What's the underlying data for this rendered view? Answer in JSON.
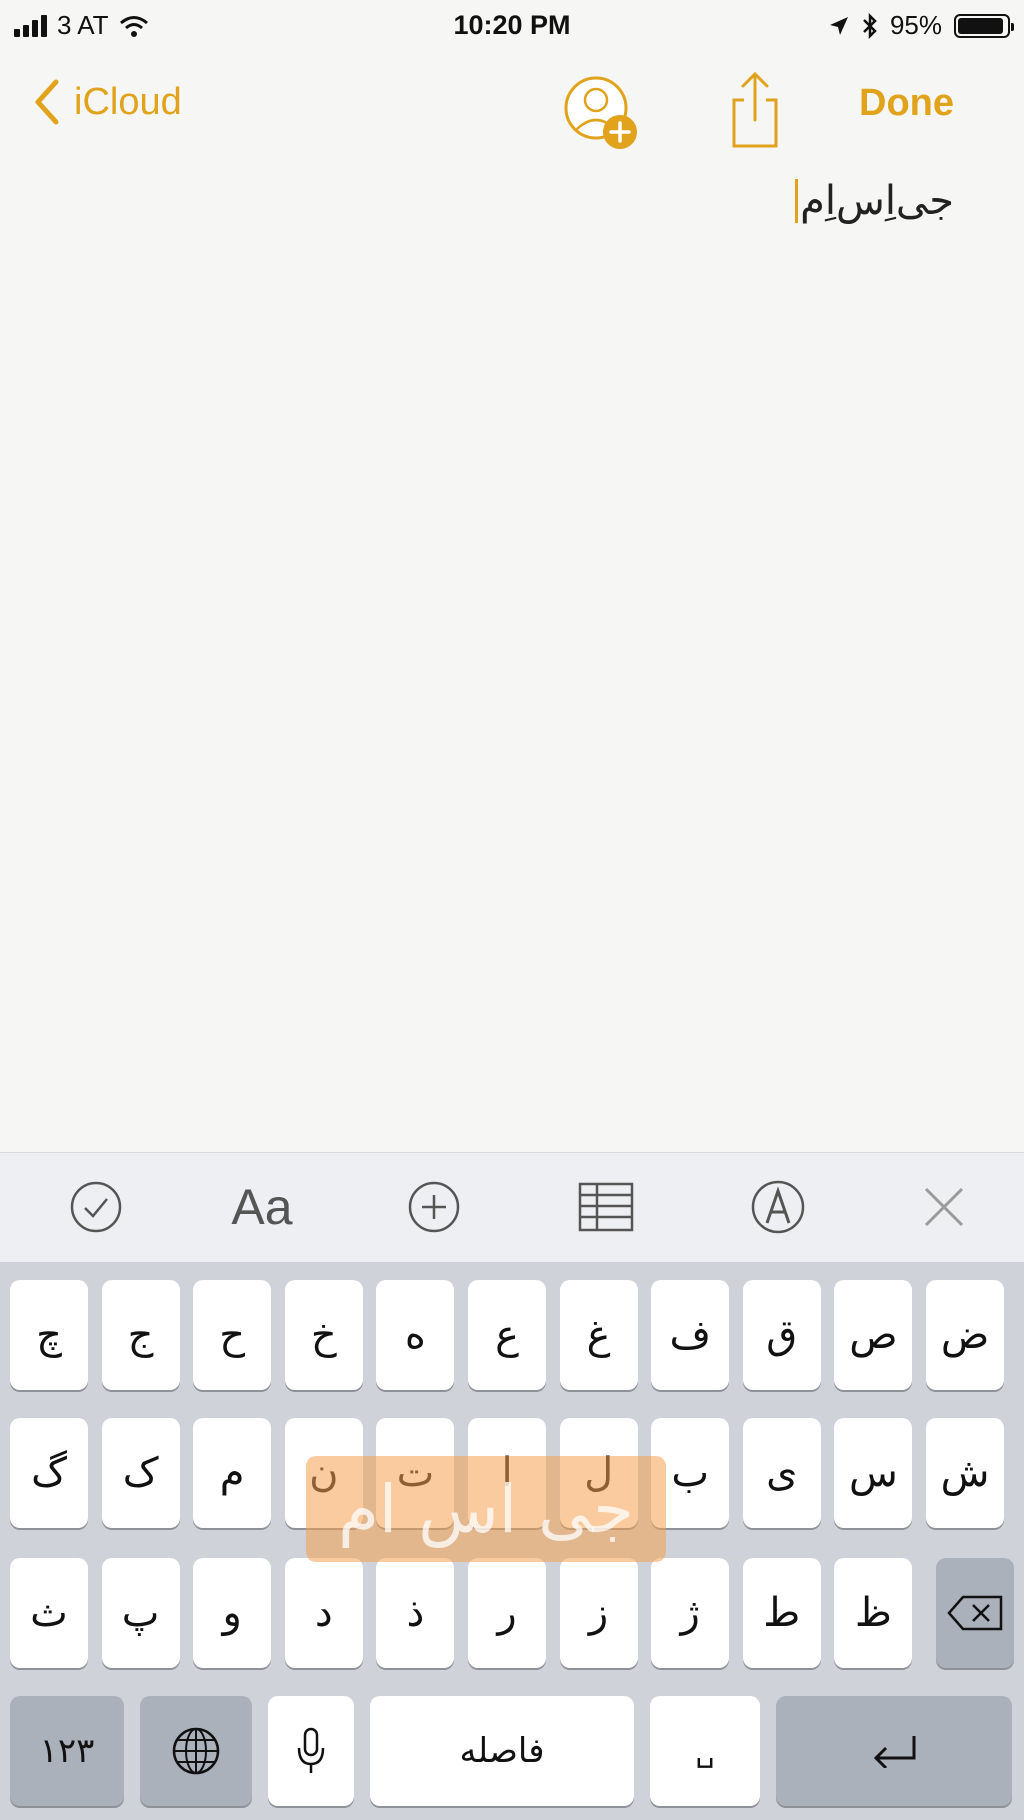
{
  "status": {
    "carrier": "3 AT",
    "time": "10:20 PM",
    "battery": "95%",
    "battery_level": 0.95
  },
  "nav": {
    "back_label": "iCloud",
    "done_label": "Done"
  },
  "note": {
    "text": "جی‌اِس‌اِم"
  },
  "colors": {
    "accent": "#e0a31b",
    "paper": "#f6f6f4",
    "key": "#ffffff",
    "key_dark": "#abb1bb",
    "keyboard_bg": "#cfd3d9"
  },
  "toolbar": {
    "format_label": "Aa",
    "icons": [
      "checklist-icon",
      "format-icon",
      "add-icon",
      "table-icon",
      "markup-icon",
      "close-icon"
    ]
  },
  "keyboard": {
    "row1": [
      "ض",
      "ص",
      "ق",
      "ف",
      "غ",
      "ع",
      "ه",
      "خ",
      "ح",
      "ج",
      "چ"
    ],
    "row2": [
      "ش",
      "س",
      "ی",
      "ب",
      "ل",
      "ا",
      "ت",
      "ن",
      "م",
      "ک",
      "گ"
    ],
    "row3": [
      "ظ",
      "ط",
      "ژ",
      "ز",
      "ر",
      "ذ",
      "د",
      "و",
      "پ",
      "ث"
    ],
    "numbers_label": "۱۲۳",
    "space_label": "فاصله",
    "zwnj_label": "␣"
  },
  "watermark": {
    "text": "جی اس ام"
  }
}
